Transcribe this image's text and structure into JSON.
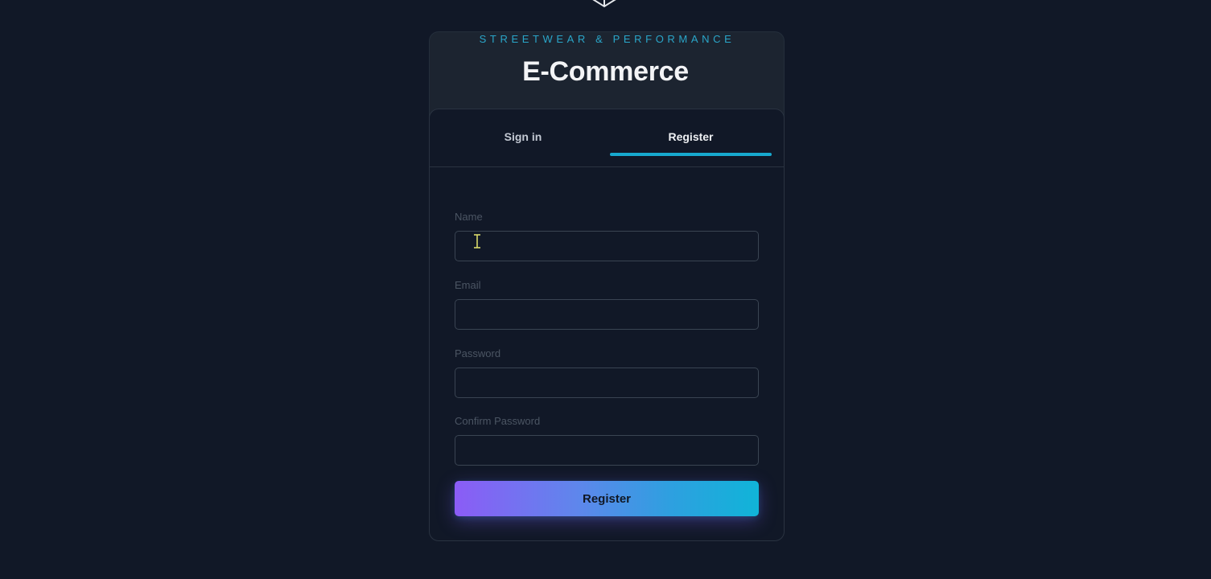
{
  "header": {
    "tagline": "STREETWEAR & PERFORMANCE",
    "title": "E-Commerce"
  },
  "tabs": [
    {
      "label": "Sign in",
      "active": false
    },
    {
      "label": "Register",
      "active": true
    }
  ],
  "form": {
    "fields": [
      {
        "label": "Name",
        "value": ""
      },
      {
        "label": "Email",
        "value": ""
      },
      {
        "label": "Password",
        "value": ""
      },
      {
        "label": "Confirm Password",
        "value": ""
      }
    ],
    "submit_label": "Register"
  },
  "colors": {
    "background": "#111827",
    "accent": "#17a9cf",
    "tagline": "#2aa6c9",
    "gradient_start": "#8b5cf6",
    "gradient_end": "#10b4d8"
  },
  "icons": {
    "logo": "chevron-down-logo-icon",
    "cursor": "text-cursor-icon"
  }
}
